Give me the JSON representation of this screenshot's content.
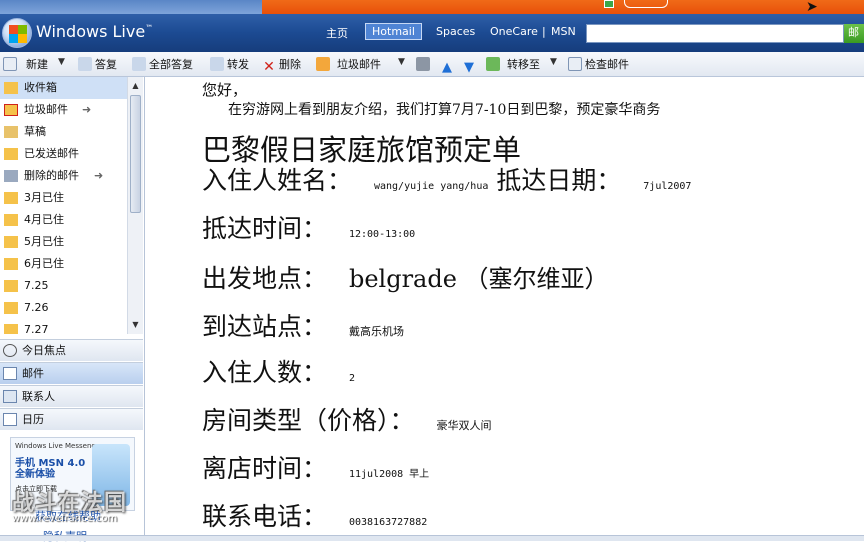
{
  "header": {
    "brand": "Windows Live",
    "brand_tm": "™",
    "nav": [
      "主页",
      "Hotmail",
      "Spaces",
      "OneCare",
      "|",
      "MSN"
    ],
    "active_nav": "Hotmail",
    "search_button": "邮"
  },
  "toolbar": {
    "new": "新建",
    "reply": "答复",
    "reply_all": "全部答复",
    "forward": "转发",
    "delete": "删除",
    "junk": "垃圾邮件",
    "move_to": "转移至",
    "check_mail": "检查邮件"
  },
  "folders": [
    {
      "label": "收件箱",
      "icon": "inbox-icon"
    },
    {
      "label": "垃圾邮件",
      "icon": "junk-icon"
    },
    {
      "label": "草稿",
      "icon": "drafts-icon"
    },
    {
      "label": "已发送邮件",
      "icon": "sent-icon"
    },
    {
      "label": "删除的邮件",
      "icon": "deleted-icon"
    },
    {
      "label": "3月已住",
      "icon": "folder-icon"
    },
    {
      "label": "4月已住",
      "icon": "folder-icon"
    },
    {
      "label": "5月已住",
      "icon": "folder-icon"
    },
    {
      "label": "6月已住",
      "icon": "folder-icon"
    },
    {
      "label": "7.25",
      "icon": "folder-icon"
    },
    {
      "label": "7.26",
      "icon": "folder-icon"
    },
    {
      "label": "7.27",
      "icon": "folder-icon"
    }
  ],
  "nav_sections": [
    {
      "label": "今日焦点",
      "icon": "clock-icon"
    },
    {
      "label": "邮件",
      "icon": "mail-icon"
    },
    {
      "label": "联系人",
      "icon": "contacts-icon"
    },
    {
      "label": "日历",
      "icon": "calendar-icon"
    }
  ],
  "ad": {
    "line1": "Windows Live Messenger",
    "line2": "手机 MSN 4.0",
    "line3": "全新体验",
    "line4": "点击立即下载",
    "link": "获取在线帮助",
    "watermark": "战斗在法国",
    "watermark_url": "www.revefrance.com"
  },
  "privacy": "隐私声明",
  "message": {
    "greeting": "您好，",
    "intro": "在穷游网上看到朋友介绍，我们打算7月7-10日到巴黎，预定豪华商务",
    "title": "巴黎假日家庭旅馆预定单",
    "rows": [
      {
        "label": "入住人姓名：",
        "value": "wang/yujie  yang/hua"
      },
      {
        "label": "抵达日期：",
        "value": "7jul2007"
      },
      {
        "label": "抵达时间：",
        "value": "12:00-13:00"
      },
      {
        "label": "出发地点：",
        "value": "belgrade （塞尔维亚）"
      },
      {
        "label": "到达站点：",
        "value": "戴高乐机场"
      },
      {
        "label": "入住人数：",
        "value": "2"
      },
      {
        "label": "房间类型（价格）：",
        "value": "豪华双人间"
      },
      {
        "label": "离店时间：",
        "value": "11jul2008 早上"
      },
      {
        "label": "联系电话：",
        "value": "0038163727882"
      }
    ]
  },
  "colors": {
    "header_blue": "#1c4a92",
    "orange_strip": "#e8500a",
    "selection": "#cfe0f6"
  }
}
